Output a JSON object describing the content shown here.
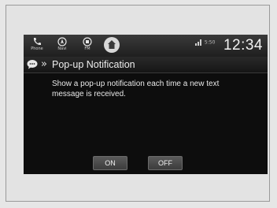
{
  "nav": {
    "items": [
      {
        "label": "Phone",
        "icon": "phone-icon"
      },
      {
        "label": "Navi",
        "icon": "navi-icon"
      },
      {
        "label": "FM",
        "icon": "radio-icon"
      },
      {
        "label": "",
        "icon": "home-icon"
      }
    ]
  },
  "status": {
    "info": "5:50",
    "clock": "12:34"
  },
  "titlebar": {
    "chevrons": "»",
    "title": "Pop-up Notification"
  },
  "body": {
    "description": "Show a pop-up notification each time a new text message is received."
  },
  "buttons": {
    "on_label": "ON",
    "off_label": "OFF"
  },
  "colors": {
    "screen_bg": "#0d0d0d",
    "text": "#e8e8e8",
    "button_bg": "#4a4a4a"
  }
}
